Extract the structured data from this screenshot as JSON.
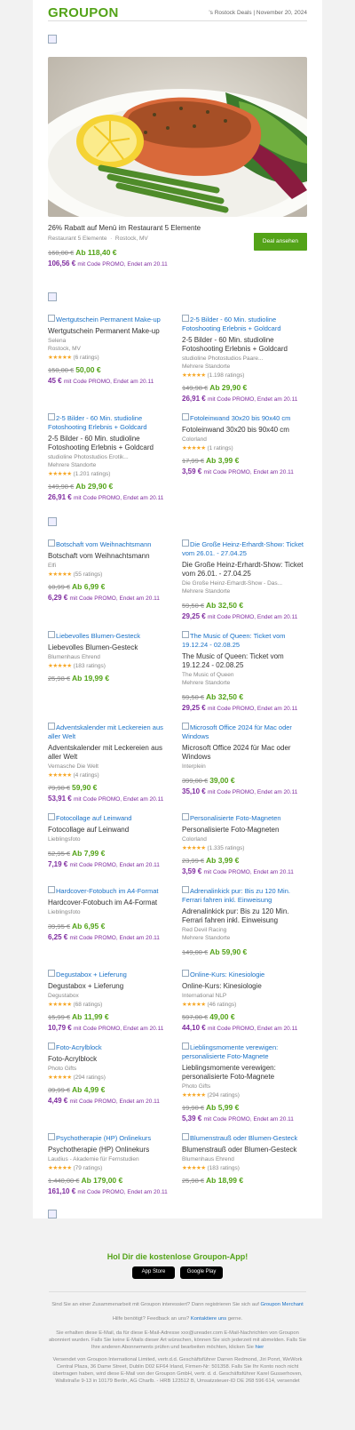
{
  "header": {
    "logo": "GROUPON",
    "info": "'s Rostock Deals | November 20, 2024"
  },
  "hero": {
    "title": "26% Rabatt auf Menü im Restaurant 5 Elemente",
    "merchant": "Restaurant 5 Elemente",
    "location": "Rostock, MV",
    "old": "160,00 €",
    "new": "Ab 118,40 €",
    "promo_price": "106,56 €",
    "promo_text": "mit Code PROMO, Endet am 20.11",
    "button": "Deal ansehen"
  },
  "grid1": [
    {
      "img": "Wertgutschein Permanent Make-up",
      "title": "Wertgutschein Permanent Make-up",
      "merchant": "Selena",
      "loc": "Rostock, MV",
      "stars": "★★★★★",
      "ratings": "(6 ratings)",
      "old": "150,00 €",
      "new": "50,00 €",
      "promo": "45 €",
      "promo_text": "mit Code PROMO, Endet am 20.11"
    },
    {
      "img": "2-5 Bilder - 60 Min. studioline Fotoshooting Erlebnis + Goldcard",
      "title": "2-5 Bilder - 60 Min. studioline Fotoshooting Erlebnis + Goldcard",
      "merchant": "studioline Photostudios Paare...",
      "loc": "Mehrere Standorte",
      "stars": "★★★★★",
      "ratings": "(1.198 ratings)",
      "old": "149,98 €",
      "new": "Ab 29,90 €",
      "promo": "26,91 €",
      "promo_text": "mit Code PROMO, Endet am 20.11"
    },
    {
      "img": "2-5 Bilder - 60 Min. studioline Fotoshooting Erlebnis + Goldcard",
      "title": "2-5 Bilder - 60 Min. studioline Fotoshooting Erlebnis + Goldcard",
      "merchant": "studioline Photostudios Erotik...",
      "loc": "Mehrere Standorte",
      "stars": "★★★★★",
      "ratings": "(1.201 ratings)",
      "old": "149,98 €",
      "new": "Ab 29,90 €",
      "promo": "26,91 €",
      "promo_text": "mit Code PROMO, Endet am 20.11"
    },
    {
      "img": "Fotoleinwand 30x20 bis 90x40 cm",
      "title": "Fotoleinwand 30x20 bis 90x40 cm",
      "merchant": "Colorland",
      "loc": "",
      "stars": "★★★★★",
      "ratings": "(1 ratings)",
      "old": "17,99 €",
      "new": "Ab 3,99 €",
      "promo": "3,59 €",
      "promo_text": "mit Code PROMO, Endet am 20.11"
    }
  ],
  "grid2": [
    {
      "img": "Botschaft vom Weihnachtsmann",
      "title": "Botschaft vom Weihnachtsmann",
      "merchant": "Elfi",
      "loc": "",
      "stars": "★★★★★",
      "ratings": "(55 ratings)",
      "old": "10,99 €",
      "new": "Ab 6,99 €",
      "promo": "6,29 €",
      "promo_text": "mit Code PROMO, Endet am 20.11"
    },
    {
      "img": "Die Große Heinz-Erhardt-Show: Ticket vom 26.01. - 27.04.25",
      "title": "Die Große Heinz-Erhardt-Show: Ticket vom 26.01. - 27.04.25",
      "merchant": "Die Große Heinz-Erhardt-Show - Das...",
      "loc": "Mehrere Standorte",
      "stars": "",
      "ratings": "",
      "old": "59,50 €",
      "new": "Ab 32,50 €",
      "promo": "29,25 €",
      "promo_text": "mit Code PROMO, Endet am 20.11"
    },
    {
      "img": "Liebevolles Blumen-Gesteck",
      "title": "Liebevolles Blumen-Gesteck",
      "merchant": "Blumenhaus Ehrend",
      "loc": "",
      "stars": "★★★★★",
      "ratings": "(183 ratings)",
      "old": "25,98 €",
      "new": "Ab 19,99 €",
      "promo": "",
      "promo_text": ""
    },
    {
      "img": "The Music of Queen: Ticket vom 19.12.24 - 02.08.25",
      "title": "The Music of Queen: Ticket vom 19.12.24 - 02.08.25",
      "merchant": "The Music of Queen",
      "loc": "Mehrere Standorte",
      "stars": "",
      "ratings": "",
      "old": "59,50 €",
      "new": "Ab 32,50 €",
      "promo": "29,25 €",
      "promo_text": "mit Code PROMO, Endet am 20.11"
    },
    {
      "img": "Adventskalender mit Leckereien aus aller Welt",
      "title": "Adventskalender mit Leckereien aus aller Welt",
      "merchant": "Vernasche Die Welt",
      "loc": "",
      "stars": "★★★★★",
      "ratings": "(4 ratings)",
      "old": "79,90 €",
      "new": "59,90 €",
      "promo": "53,91 €",
      "promo_text": "mit Code PROMO, Endet am 20.11"
    },
    {
      "img": "Microsoft Office 2024 für Mac oder Windows",
      "title": "Microsoft Office 2024 für Mac oder Windows",
      "merchant": "Interplein",
      "loc": "",
      "stars": "",
      "ratings": "",
      "old": "399,00 €",
      "new": "39,00 €",
      "promo": "35,10 €",
      "promo_text": "mit Code PROMO, Endet am 20.11"
    },
    {
      "img": "Fotocollage auf Leinwand",
      "title": "Fotocollage auf Leinwand",
      "merchant": "Lieblingsfoto",
      "loc": "",
      "stars": "",
      "ratings": "",
      "old": "52,95 €",
      "new": "Ab 7,99 €",
      "promo": "7,19 €",
      "promo_text": "mit Code PROMO, Endet am 20.11"
    },
    {
      "img": "Personalisierte Foto-Magneten",
      "title": "Personalisierte Foto-Magneten",
      "merchant": "Colorland",
      "loc": "",
      "stars": "★★★★★",
      "ratings": "(1.335 ratings)",
      "old": "23,99 €",
      "new": "Ab 3,99 €",
      "promo": "3,59 €",
      "promo_text": "mit Code PROMO, Endet am 20.11"
    },
    {
      "img": "Hardcover-Fotobuch im A4-Format",
      "title": "Hardcover-Fotobuch im A4-Format",
      "merchant": "Lieblingsfoto",
      "loc": "",
      "stars": "",
      "ratings": "",
      "old": "39,95 €",
      "new": "Ab 6,95 €",
      "promo": "6,25 €",
      "promo_text": "mit Code PROMO, Endet am 20.11"
    },
    {
      "img": "Adrenalinkick pur: Bis zu 120 Min. Ferrari fahren inkl. Einweisung",
      "title": "Adrenalinkick pur: Bis zu 120 Min. Ferrari fahren inkl. Einweisung",
      "merchant": "Red Devil Racing",
      "loc": "Mehrere Standorte",
      "stars": "",
      "ratings": "",
      "old": "149,00 €",
      "new": "Ab 59,90 €",
      "promo": "",
      "promo_text": ""
    },
    {
      "img": "Degustabox + Lieferung",
      "title": "Degustabox + Lieferung",
      "merchant": "Degustabox",
      "loc": "",
      "stars": "★★★★★",
      "ratings": "(68 ratings)",
      "old": "15,99 €",
      "new": "Ab 11,99 €",
      "promo": "10,79 €",
      "promo_text": "mit Code PROMO, Endet am 20.11"
    },
    {
      "img": "Online-Kurs: Kinesiologie",
      "title": "Online-Kurs: Kinesiologie",
      "merchant": "International NLP",
      "loc": "",
      "stars": "★★★★★",
      "ratings": "(46 ratings)",
      "old": "597,00 €",
      "new": "49,00 €",
      "promo": "44,10 €",
      "promo_text": "mit Code PROMO, Endet am 20.11"
    },
    {
      "img": "Foto-Acrylblock",
      "title": "Foto-Acrylblock",
      "merchant": "Photo Gifts",
      "loc": "",
      "stars": "★★★★★",
      "ratings": "(294 ratings)",
      "old": "39,99 €",
      "new": "Ab 4,99 €",
      "promo": "4,49 €",
      "promo_text": "mit Code PROMO, Endet am 20.11"
    },
    {
      "img": "Lieblingsmomente verewigen: personalisierte Foto-Magnete",
      "title": "Lieblingsmomente verewigen: personalisierte Foto-Magnete",
      "merchant": "Photo Gifts",
      "loc": "",
      "stars": "★★★★★",
      "ratings": "(294 ratings)",
      "old": "19,90 €",
      "new": "Ab 5,99 €",
      "promo": "5,39 €",
      "promo_text": "mit Code PROMO, Endet am 20.11"
    },
    {
      "img": "Psychotherapie (HP) Onlinekurs",
      "title": "Psychotherapie (HP) Onlinekurs",
      "merchant": "Laudius - Akademie für Fernstudien",
      "loc": "",
      "stars": "★★★★★",
      "ratings": "(79 ratings)",
      "old": "1.440,00 €",
      "new": "Ab 179,00 €",
      "promo": "161,10 €",
      "promo_text": "mit Code PROMO, Endet am 20.11"
    },
    {
      "img": "Blumenstrauß oder Blumen-Gesteck",
      "title": "Blumenstrauß oder Blumen-Gesteck",
      "merchant": "Blumenhaus Ehrend",
      "loc": "",
      "stars": "★★★★★",
      "ratings": "(183 ratings)",
      "old": "25,98 €",
      "new": "Ab 18,99 €",
      "promo": "",
      "promo_text": ""
    }
  ],
  "app": {
    "title": "Hol Dir die kostenlose Groupon-App!",
    "appstore": "App Store",
    "googleplay": "Google Play"
  },
  "footer": {
    "merchant_text": "Sind Sie an einer Zusammenarbeit mit Groupon interessiert? Dann registrieren Sie sich auf",
    "merchant_link": "Groupon Merchant",
    "help_text": "Hilfe benötigt? Feedback an uns?",
    "help_link": "Kontaktiere uns",
    "help_tail": "gerne.",
    "legal1": "Sie erhalten diese E-Mail, da für diese E-Mail-Adresse xxx@ureader.com E-Mail-Nachrichten von Groupon abonniert wurden. Falls Sie keine E-Mails dieser Art wünschen, können Sie sich jederzeit mit abmelden. Falls Sie Ihre anderen Abonnements prüfen und bearbeiten möchten, klicken Sie",
    "legal1_link": "hier",
    "legal2": "Versendet von Groupon International Limited, vertr.d.d. Geschäftsführer Darren Redmond, Jiri Ponrt, WeWork Central Plaza, 36 Dame Street, Dublin D02 EF64 Irland, Firmen-Nr: 501358. Falls Sie Ihr Konto noch nicht übertragen haben, wird diese E-Mail von der Groupon GmbH, vertr. d. d. Geschäftsführer Karel Gusserhoven, Wallstraße 9-13 in 10179 Berlin, AG Charlb. - HRB 123512 B, Umsatzsteuer-ID DE 268 596 614, versendet"
  }
}
